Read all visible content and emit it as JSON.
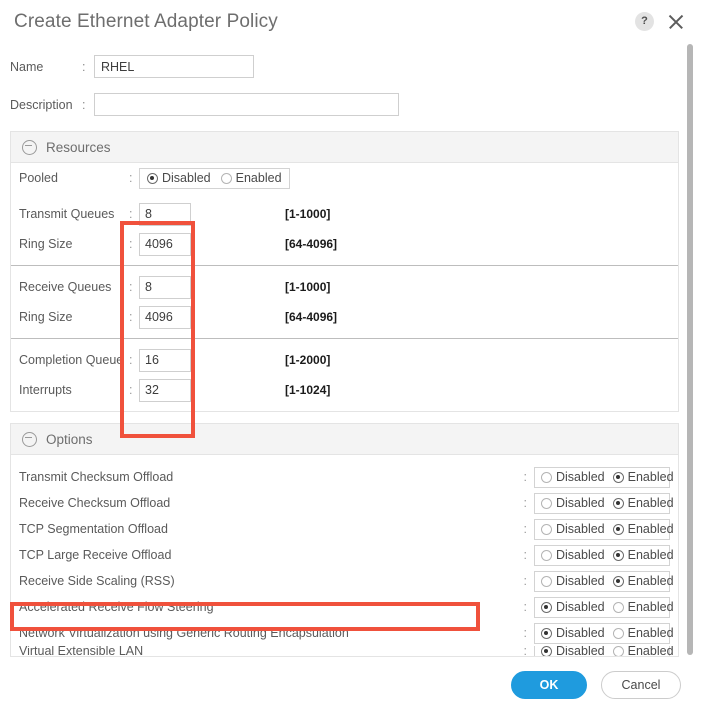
{
  "dialog": {
    "title": "Create Ethernet Adapter Policy",
    "help_icon": "help-icon",
    "close_icon": "close-icon"
  },
  "fields": {
    "name": {
      "label": "Name",
      "colon": ":",
      "value": "RHEL",
      "placeholder": ""
    },
    "description": {
      "label": "Description",
      "colon": ":",
      "value": "",
      "placeholder": ""
    }
  },
  "resources": {
    "title": "Resources",
    "pooled": {
      "label": "Pooled",
      "colon": ":",
      "options": [
        "Disabled",
        "Enabled"
      ],
      "selected": "Disabled"
    },
    "groups": [
      {
        "rows": [
          {
            "label": "Transmit Queues",
            "colon": ":",
            "value": "8",
            "range": "[1-1000]"
          },
          {
            "label": "Ring Size",
            "colon": ":",
            "value": "4096",
            "range": "[64-4096]"
          }
        ]
      },
      {
        "rows": [
          {
            "label": "Receive Queues",
            "colon": ":",
            "value": "8",
            "range": "[1-1000]"
          },
          {
            "label": "Ring Size",
            "colon": ":",
            "value": "4096",
            "range": "[64-4096]"
          }
        ]
      },
      {
        "rows": [
          {
            "label": "Completion Queue",
            "colon": ":",
            "value": "16",
            "range": "[1-2000]"
          },
          {
            "label": "Interrupts",
            "colon": ":",
            "value": "32",
            "range": "[1-1024]"
          }
        ]
      }
    ]
  },
  "options": {
    "title": "Options",
    "radio_labels": {
      "disabled": "Disabled",
      "enabled": "Enabled"
    },
    "rows": [
      {
        "label": "Transmit Checksum Offload",
        "colon": ":",
        "selected": "Enabled"
      },
      {
        "label": "Receive Checksum Offload",
        "colon": ":",
        "selected": "Enabled"
      },
      {
        "label": "TCP Segmentation Offload",
        "colon": ":",
        "selected": "Enabled"
      },
      {
        "label": "TCP Large Receive Offload",
        "colon": ":",
        "selected": "Enabled"
      },
      {
        "label": "Receive Side Scaling (RSS)",
        "colon": ":",
        "selected": "Enabled"
      },
      {
        "label": "Accelerated Receive Flow Steering",
        "colon": ":",
        "selected": "Disabled"
      },
      {
        "label": "Network Virtualization using Generic Routing Encapsulation",
        "colon": ":",
        "selected": "Disabled"
      },
      {
        "label": "Virtual Extensible LAN",
        "colon": ":",
        "selected": "Disabled"
      }
    ]
  },
  "footer": {
    "ok_label": "OK",
    "cancel_label": "Cancel"
  },
  "annotations": {
    "color": "#f0513c",
    "boxes": [
      "resources-queue-inputs",
      "receive-side-scaling-row"
    ]
  }
}
